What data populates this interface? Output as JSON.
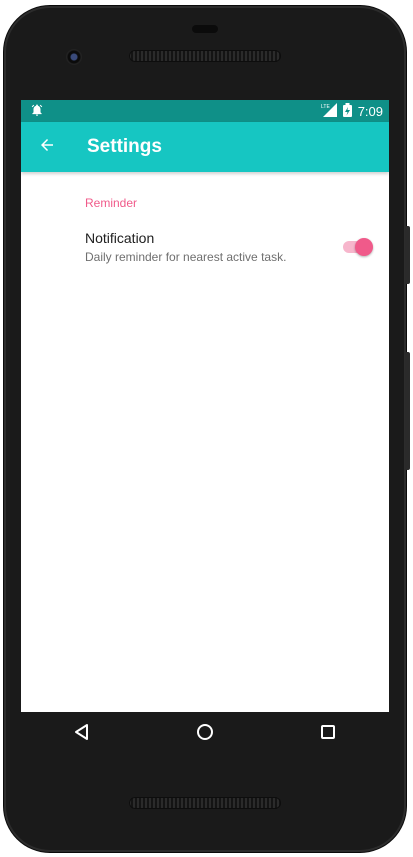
{
  "status": {
    "time": "7:09",
    "network": "LTE"
  },
  "appbar": {
    "title": "Settings"
  },
  "section": {
    "header": "Reminder"
  },
  "pref": {
    "title": "Notification",
    "summary": "Daily reminder for nearest active task.",
    "enabled": true
  },
  "colors": {
    "status_bar": "#0f9088",
    "app_bar": "#16c6c2",
    "accent": "#f05a8a"
  },
  "icons": {
    "status_left": "alarm-icon",
    "status_right": [
      "lte-signal-icon",
      "battery-charging-icon"
    ],
    "appbar": "arrow-back-icon",
    "nav": [
      "nav-back-icon",
      "nav-home-icon",
      "nav-recents-icon"
    ]
  }
}
